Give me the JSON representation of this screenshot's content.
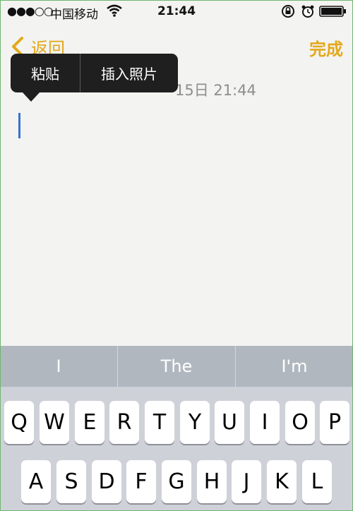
{
  "status_bar": {
    "signal": "●●●○○",
    "carrier": "中国移动",
    "time": "21:44",
    "icons": [
      "wifi-icon",
      "rotation-lock-icon",
      "alarm-icon",
      "battery-icon"
    ]
  },
  "nav": {
    "back_label": "返回",
    "done_label": "完成"
  },
  "note": {
    "date_visible": "15日 21:44"
  },
  "context_menu": {
    "items": [
      "粘贴",
      "插入照片"
    ]
  },
  "predictions": [
    "I",
    "The",
    "I'm"
  ],
  "keyboard": {
    "row1": [
      "Q",
      "W",
      "E",
      "R",
      "T",
      "Y",
      "U",
      "I",
      "O",
      "P"
    ],
    "row2": [
      "A",
      "S",
      "D",
      "F",
      "G",
      "H",
      "J",
      "K",
      "L"
    ]
  },
  "colors": {
    "accent": "#e3a81b",
    "cursor": "#3d6fd0",
    "menu_bg": "#1f1f1f"
  }
}
